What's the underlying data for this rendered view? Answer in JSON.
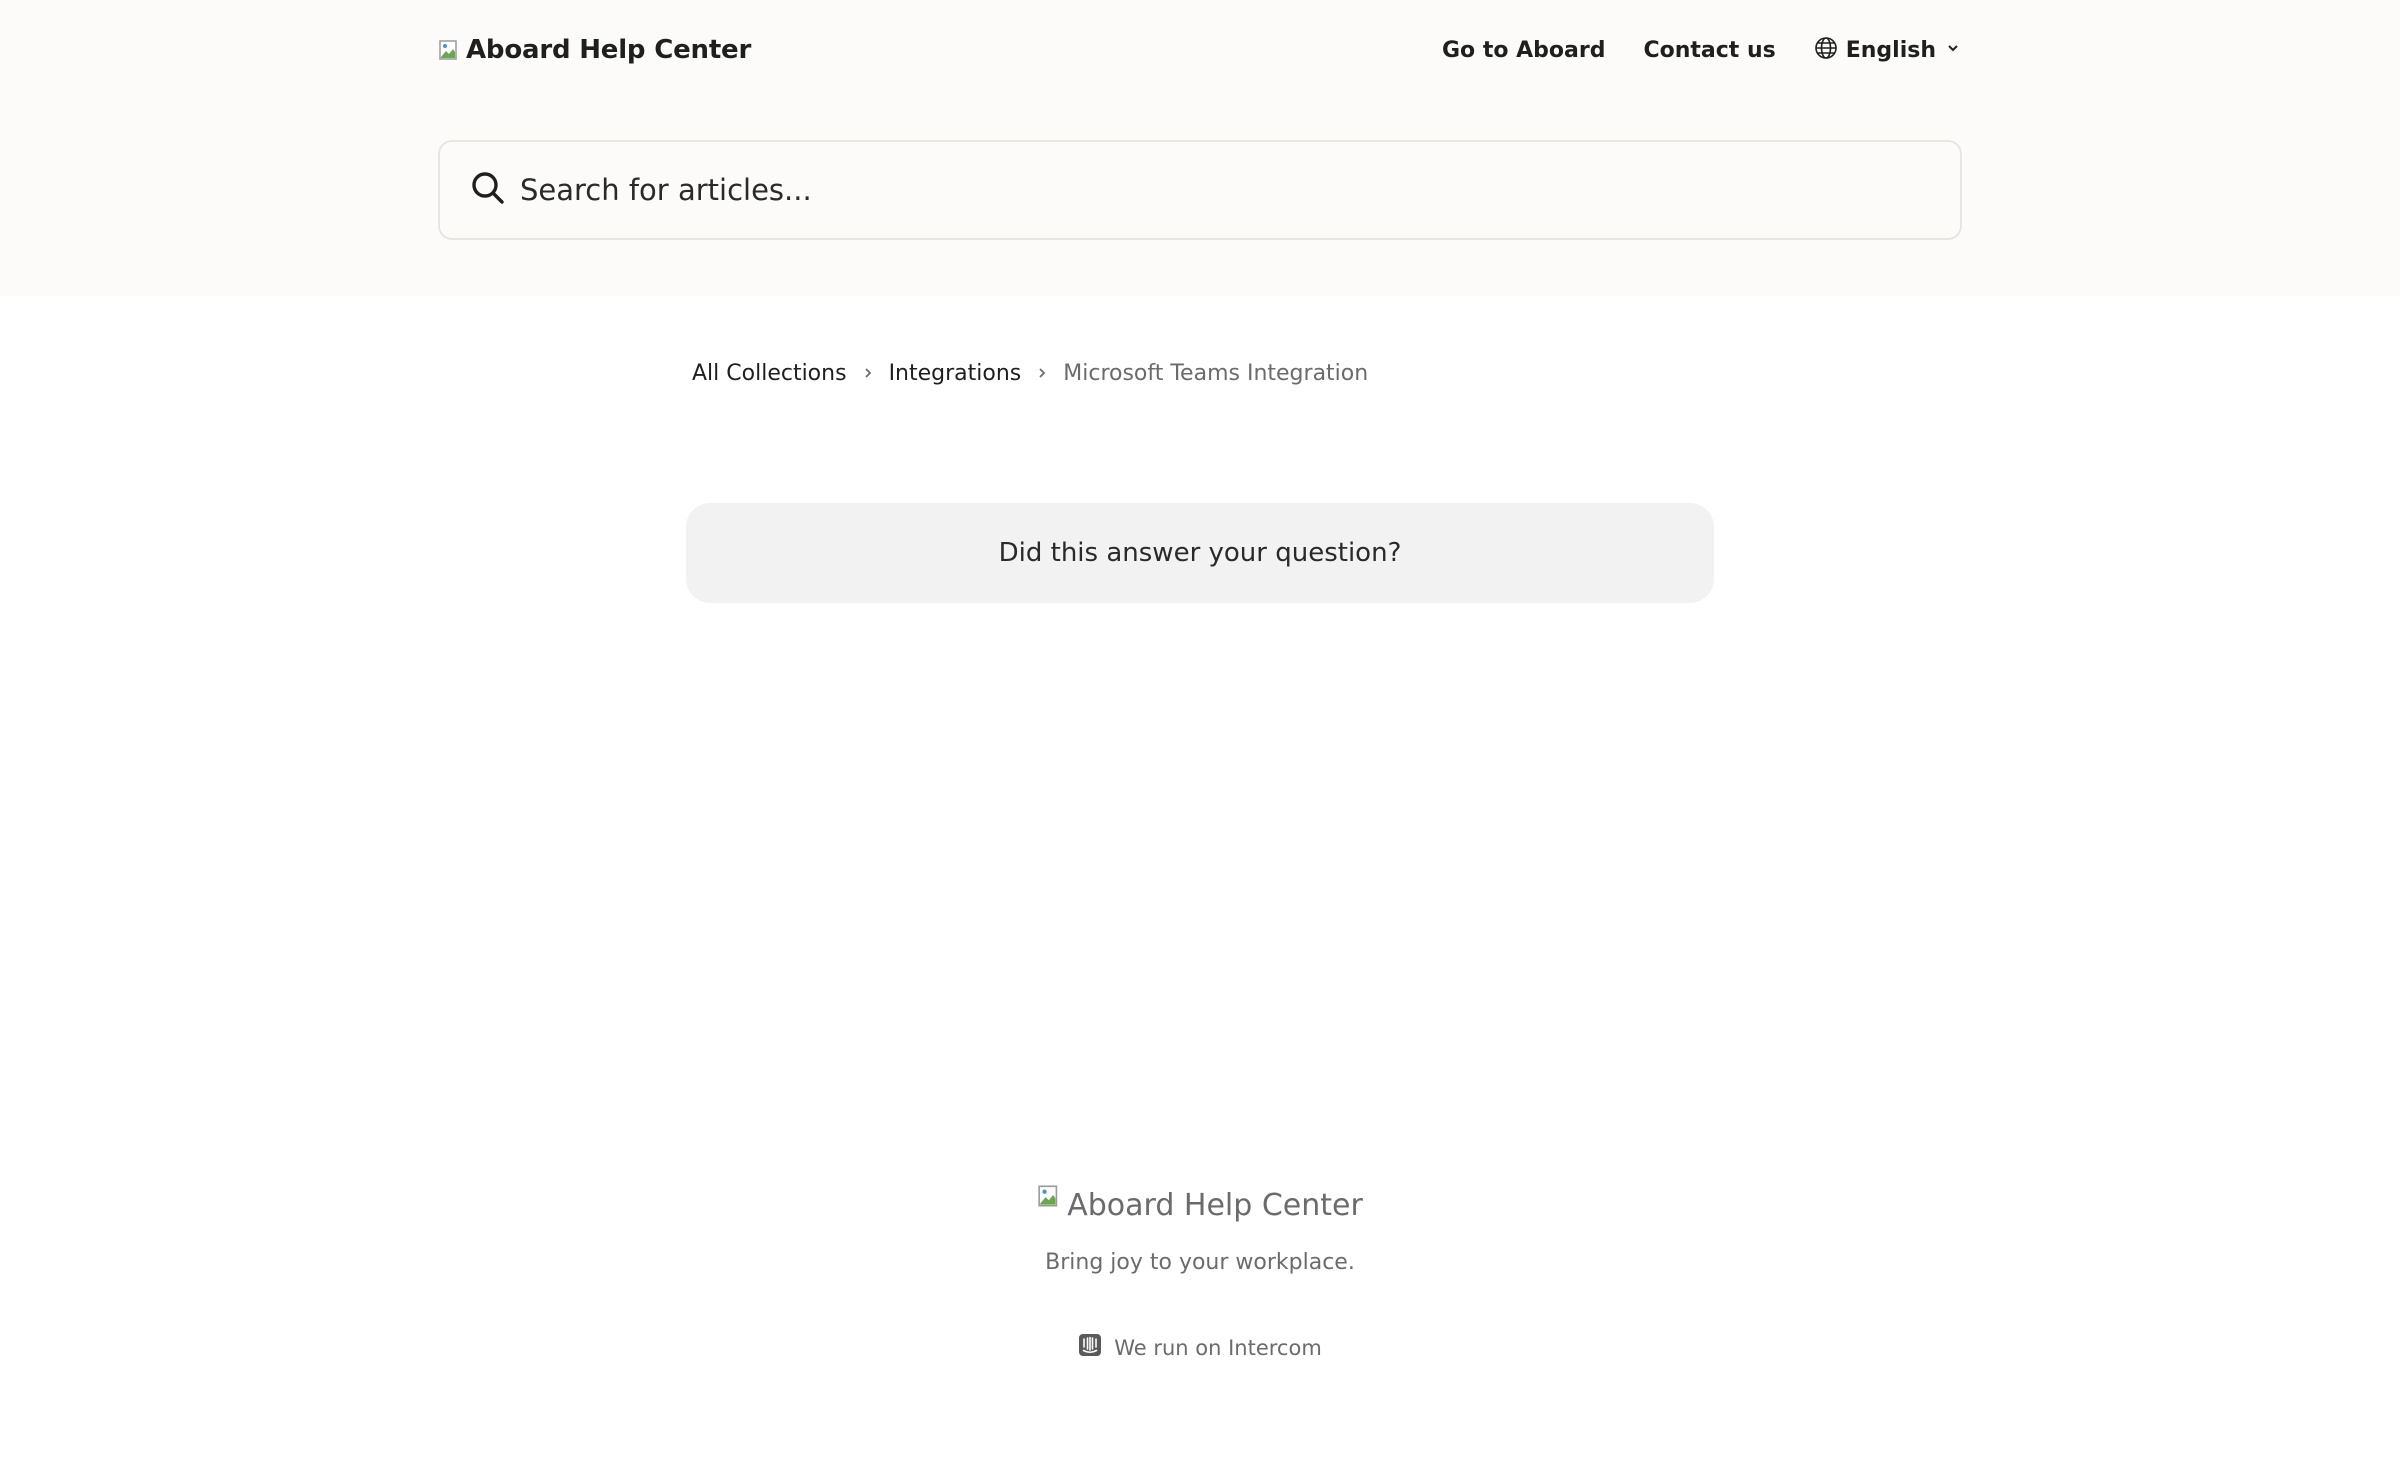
{
  "header": {
    "logo_alt": "Aboard Help Center",
    "nav": {
      "go_to": "Go to Aboard",
      "contact": "Contact us",
      "language": "English"
    }
  },
  "search": {
    "placeholder": "Search for articles..."
  },
  "breadcrumb": {
    "items": [
      "All Collections",
      "Integrations"
    ],
    "current": "Microsoft Teams Integration"
  },
  "feedback": {
    "question": "Did this answer your question?"
  },
  "footer": {
    "logo_alt": "Aboard Help Center",
    "tagline": "Bring joy to your workplace.",
    "powered_by": "We run on Intercom"
  },
  "icons": [
    "broken-image-icon",
    "globe-icon",
    "chevron-down-icon",
    "search-icon",
    "chevron-right-icon",
    "intercom-icon"
  ],
  "colors": {
    "header_bg": "#fcfbfa",
    "feedback_bg": "#f2f2f2",
    "muted_text": "#6b6b6b"
  }
}
